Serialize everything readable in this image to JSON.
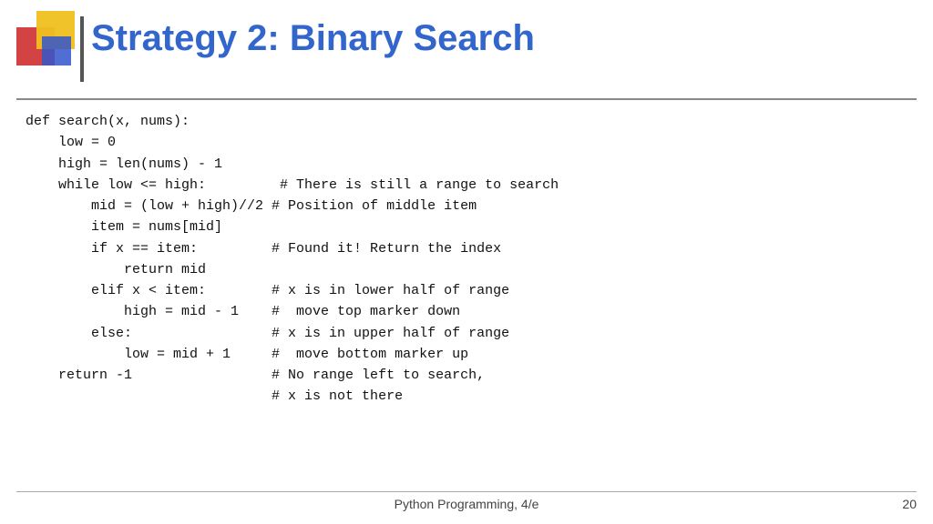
{
  "title": "Strategy 2: Binary Search",
  "code": "def search(x, nums):\n    low = 0\n    high = len(nums) - 1\n    while low <= high:         # There is still a range to search\n        mid = (low + high)//2 # Position of middle item\n        item = nums[mid]\n        if x == item:         # Found it! Return the index\n            return mid\n        elif x < item:        # x is in lower half of range\n            high = mid - 1    #  move top marker down\n        else:                 # x is in upper half of range\n            low = mid + 1     #  move bottom marker up\n    return -1                 # No range left to search,\n                              # x is not there",
  "footer": {
    "center_text": "Python Programming, 4/e",
    "page_number": "20"
  }
}
